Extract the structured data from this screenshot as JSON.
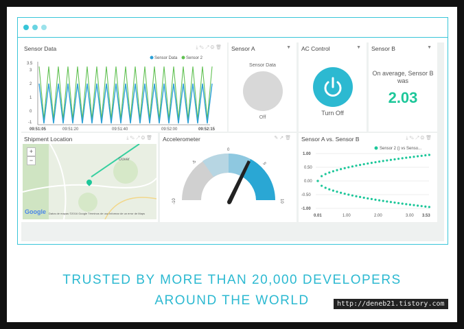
{
  "colors": {
    "accent": "#37c5d8",
    "blue": "#2a9fd6",
    "green": "#61c152",
    "teal": "#1dc79a",
    "gray": "#d8d8d8"
  },
  "sensor_data": {
    "title": "Sensor Data",
    "legend": [
      "Sensor Data",
      "Sensor 2"
    ],
    "y_ticks": [
      "3.5",
      "3",
      "2",
      "1",
      "0",
      "-1"
    ],
    "x_ticks": [
      "09:51:05",
      "09:51:20",
      "09:51:40",
      "09:52:00",
      "09:52:15"
    ]
  },
  "sensor_a": {
    "title": "Sensor A",
    "subtitle": "Sensor Data",
    "state": "Off"
  },
  "ac_control": {
    "title": "AC Control",
    "state": "Turn Off"
  },
  "sensor_b": {
    "title": "Sensor B",
    "text": "On average, Sensor B was",
    "value": "2.03"
  },
  "shipment": {
    "title": "Shipment Location",
    "zoom_in": "+",
    "zoom_out": "−",
    "place": "Dover",
    "brand": "Google",
    "footer": "Datos de mapas ©2016 Google   Términos de uso   Informar de un error de Maps"
  },
  "accelerometer": {
    "title": "Accelerometer",
    "ticks": [
      "-10",
      "-5",
      "0",
      "5",
      "10"
    ]
  },
  "scatter": {
    "title": "Sensor A vs. Sensor B",
    "legend": "Sensor 2 () vs Senso...",
    "y_ticks": [
      "1.00",
      "0.50",
      "0.00",
      "-0.50",
      "-1.00"
    ],
    "x_ticks": [
      "0.01",
      "1.00",
      "2.00",
      "3.00",
      "3.53"
    ]
  },
  "tagline": {
    "line1": "TRUSTED BY MORE THAN 20,000 DEVELOPERS",
    "line2": "AROUND THE WORLD"
  },
  "url": "http://deneb21.tistory.com"
}
